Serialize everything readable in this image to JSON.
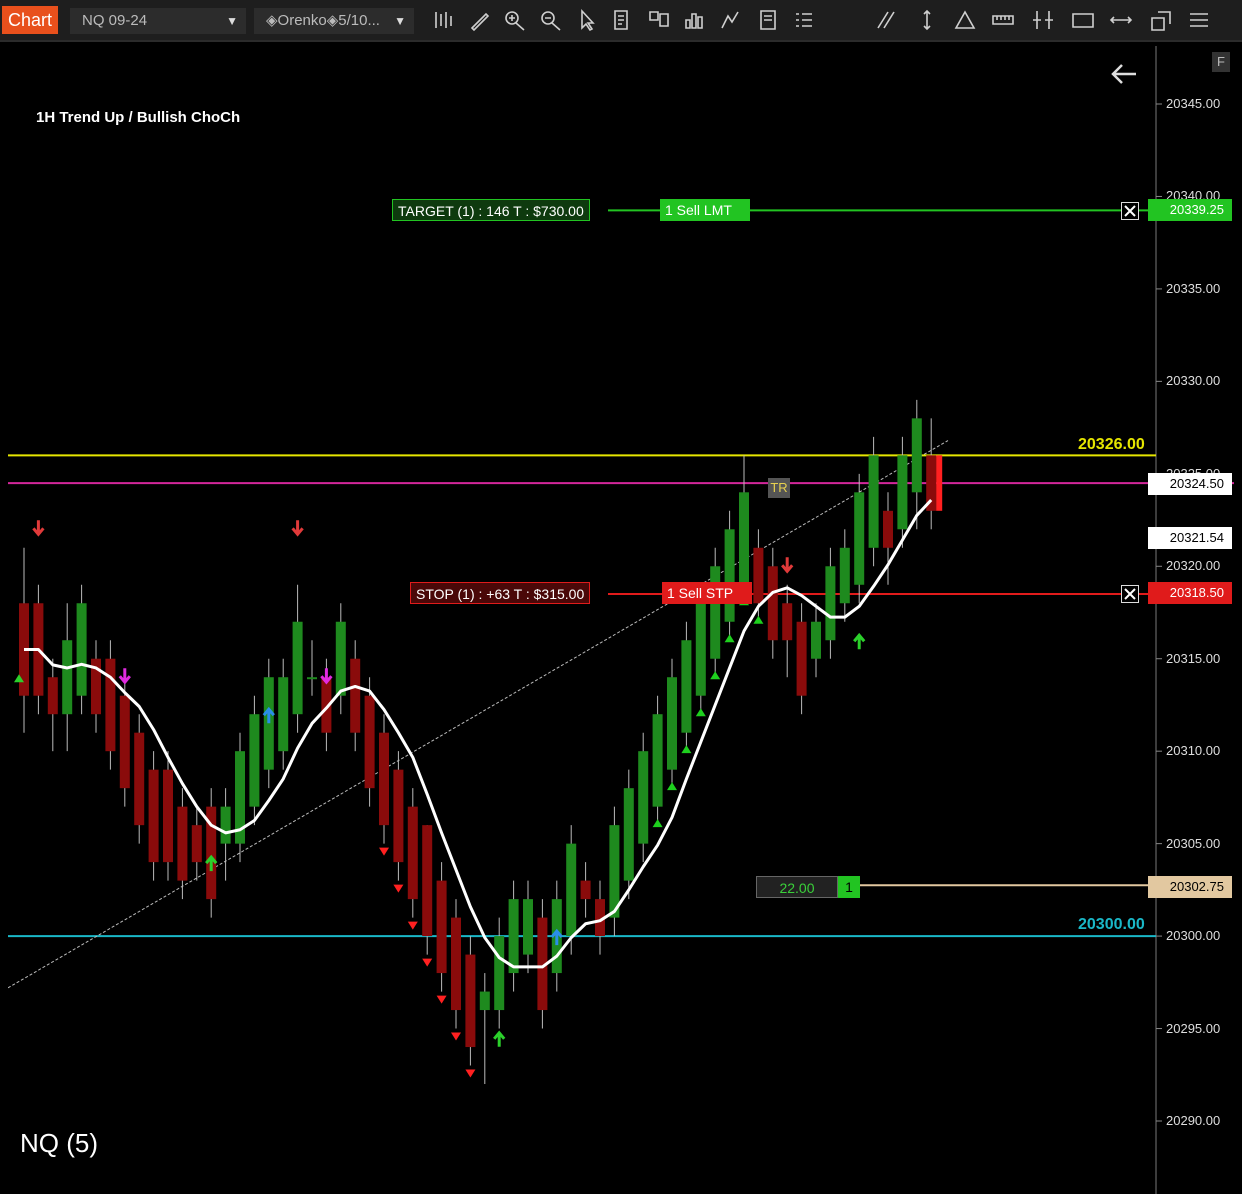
{
  "toolbar": {
    "chart_tab": "Chart",
    "instrument_dropdown": "NQ 09-24",
    "bar_type_dropdown": "◈Orenko◈5/10...",
    "icons": [
      "bar-type-icon",
      "draw-pencil-icon",
      "zoom-in-icon",
      "zoom-out-icon",
      "pointer-icon",
      "data-box-icon",
      "chart-trader-icon",
      "strategies-icon",
      "indicators-icon",
      "templates-icon",
      "properties-icon",
      "lines-icon",
      "vertical-line-icon",
      "triangle-icon",
      "ruler-icon",
      "fib-icon",
      "rectangle-icon",
      "arrows-icon",
      "drawing-objects-icon",
      "menu-icon"
    ]
  },
  "chart": {
    "title": "1H Trend Up / Bullish ChoCh",
    "instrument_label": "NQ (5)",
    "f_button": "F",
    "axis_labels": [
      "20345.00",
      "20340.00",
      "20335.00",
      "20330.00",
      "20325.00",
      "20320.00",
      "20315.00",
      "20310.00",
      "20305.00",
      "20300.00",
      "20295.00",
      "20290.00"
    ],
    "target_label": "TARGET (1)  :  146 T  :  $730.00",
    "target_order": "1  Sell LMT",
    "target_price": "20339.25",
    "stop_label": "STOP (1)  :  +63 T  :  $315.00",
    "stop_order": "1  Sell STP",
    "stop_price": "20318.50",
    "yellow_level": "20326.00",
    "cyan_level": "20300.00",
    "magenta_price": "20324.50",
    "ma_price": "20321.54",
    "entry_qty": "22.00",
    "entry_pos": "1",
    "entry_price": "20302.75",
    "tr_marker": "TR",
    "colors": {
      "bull": "#1e8a1e",
      "bear": "#8a0b0b",
      "target": "#22c422",
      "stop": "#e01b1b",
      "yellow": "#e6e600",
      "magenta": "#d4279b",
      "cyan": "#1ab8c8",
      "entry": "#e2c8a0"
    }
  },
  "chart_data": {
    "type": "candlestick",
    "y_axis": {
      "min": 20290,
      "max": 20345,
      "step": 5
    },
    "price_levels": [
      {
        "name": "target",
        "price": 20339.25
      },
      {
        "name": "yellow",
        "price": 20326.0
      },
      {
        "name": "magenta",
        "price": 20324.5
      },
      {
        "name": "stop",
        "price": 20318.5
      },
      {
        "name": "entry",
        "price": 20302.75
      },
      {
        "name": "cyan",
        "price": 20300.0
      }
    ],
    "bars": [
      {
        "o": 20318,
        "c": 20313,
        "h": 20321,
        "l": 20311
      },
      {
        "o": 20318,
        "c": 20313,
        "h": 20319,
        "l": 20312
      },
      {
        "o": 20314,
        "c": 20312,
        "h": 20315,
        "l": 20310
      },
      {
        "o": 20312,
        "c": 20316,
        "h": 20318,
        "l": 20310
      },
      {
        "o": 20313,
        "c": 20318,
        "h": 20319,
        "l": 20312
      },
      {
        "o": 20315,
        "c": 20312,
        "h": 20316,
        "l": 20311
      },
      {
        "o": 20315,
        "c": 20310,
        "h": 20316,
        "l": 20309
      },
      {
        "o": 20313,
        "c": 20308,
        "h": 20314,
        "l": 20307
      },
      {
        "o": 20311,
        "c": 20306,
        "h": 20312,
        "l": 20305
      },
      {
        "o": 20309,
        "c": 20304,
        "h": 20310,
        "l": 20303
      },
      {
        "o": 20309,
        "c": 20304,
        "h": 20310,
        "l": 20303
      },
      {
        "o": 20307,
        "c": 20303,
        "h": 20308,
        "l": 20302
      },
      {
        "o": 20306,
        "c": 20304,
        "h": 20307,
        "l": 20303
      },
      {
        "o": 20307,
        "c": 20302,
        "h": 20308,
        "l": 20301
      },
      {
        "o": 20305,
        "c": 20307,
        "h": 20308,
        "l": 20303
      },
      {
        "o": 20305,
        "c": 20310,
        "h": 20311,
        "l": 20304
      },
      {
        "o": 20307,
        "c": 20312,
        "h": 20313,
        "l": 20306
      },
      {
        "o": 20309,
        "c": 20314,
        "h": 20315,
        "l": 20308
      },
      {
        "o": 20310,
        "c": 20314,
        "h": 20315,
        "l": 20309
      },
      {
        "o": 20312,
        "c": 20317,
        "h": 20319,
        "l": 20311
      },
      {
        "o": 20314,
        "c": 20314,
        "h": 20316,
        "l": 20313
      },
      {
        "o": 20314,
        "c": 20311,
        "h": 20315,
        "l": 20310
      },
      {
        "o": 20313,
        "c": 20317,
        "h": 20318,
        "l": 20312
      },
      {
        "o": 20315,
        "c": 20311,
        "h": 20316,
        "l": 20310
      },
      {
        "o": 20313,
        "c": 20308,
        "h": 20314,
        "l": 20307
      },
      {
        "o": 20311,
        "c": 20306,
        "h": 20312,
        "l": 20305
      },
      {
        "o": 20309,
        "c": 20304,
        "h": 20310,
        "l": 20303
      },
      {
        "o": 20307,
        "c": 20302,
        "h": 20308,
        "l": 20301
      },
      {
        "o": 20306,
        "c": 20300,
        "h": 20306,
        "l": 20299
      },
      {
        "o": 20303,
        "c": 20298,
        "h": 20304,
        "l": 20297
      },
      {
        "o": 20301,
        "c": 20296,
        "h": 20302,
        "l": 20295
      },
      {
        "o": 20299,
        "c": 20294,
        "h": 20300,
        "l": 20293
      },
      {
        "o": 20296,
        "c": 20297,
        "h": 20298,
        "l": 20292
      },
      {
        "o": 20296,
        "c": 20300,
        "h": 20301,
        "l": 20295
      },
      {
        "o": 20298,
        "c": 20302,
        "h": 20303,
        "l": 20297
      },
      {
        "o": 20299,
        "c": 20302,
        "h": 20303,
        "l": 20298
      },
      {
        "o": 20301,
        "c": 20296,
        "h": 20302,
        "l": 20295
      },
      {
        "o": 20298,
        "c": 20302,
        "h": 20303,
        "l": 20297
      },
      {
        "o": 20300,
        "c": 20305,
        "h": 20306,
        "l": 20299
      },
      {
        "o": 20303,
        "c": 20302,
        "h": 20304,
        "l": 20301
      },
      {
        "o": 20302,
        "c": 20300,
        "h": 20303,
        "l": 20299
      },
      {
        "o": 20301,
        "c": 20306,
        "h": 20307,
        "l": 20300
      },
      {
        "o": 20303,
        "c": 20308,
        "h": 20309,
        "l": 20302
      },
      {
        "o": 20305,
        "c": 20310,
        "h": 20311,
        "l": 20304
      },
      {
        "o": 20307,
        "c": 20312,
        "h": 20313,
        "l": 20306
      },
      {
        "o": 20309,
        "c": 20314,
        "h": 20315,
        "l": 20308
      },
      {
        "o": 20311,
        "c": 20316,
        "h": 20317,
        "l": 20310
      },
      {
        "o": 20313,
        "c": 20318,
        "h": 20319,
        "l": 20312
      },
      {
        "o": 20315,
        "c": 20320,
        "h": 20321,
        "l": 20314
      },
      {
        "o": 20317,
        "c": 20322,
        "h": 20323,
        "l": 20316
      },
      {
        "o": 20319,
        "c": 20324,
        "h": 20326,
        "l": 20318
      },
      {
        "o": 20321,
        "c": 20318,
        "h": 20322,
        "l": 20317
      },
      {
        "o": 20320,
        "c": 20316,
        "h": 20321,
        "l": 20315
      },
      {
        "o": 20318,
        "c": 20316,
        "h": 20319,
        "l": 20314
      },
      {
        "o": 20317,
        "c": 20313,
        "h": 20318,
        "l": 20312
      },
      {
        "o": 20315,
        "c": 20317,
        "h": 20318,
        "l": 20314
      },
      {
        "o": 20316,
        "c": 20320,
        "h": 20321,
        "l": 20315
      },
      {
        "o": 20318,
        "c": 20321,
        "h": 20322,
        "l": 20317
      },
      {
        "o": 20319,
        "c": 20324,
        "h": 20325,
        "l": 20318
      },
      {
        "o": 20321,
        "c": 20326,
        "h": 20327,
        "l": 20320
      },
      {
        "o": 20323,
        "c": 20321,
        "h": 20324,
        "l": 20319
      },
      {
        "o": 20322,
        "c": 20326,
        "h": 20327,
        "l": 20321
      },
      {
        "o": 20324,
        "c": 20328,
        "h": 20329,
        "l": 20322
      },
      {
        "o": 20326,
        "c": 20323,
        "h": 20328,
        "l": 20322
      }
    ]
  }
}
